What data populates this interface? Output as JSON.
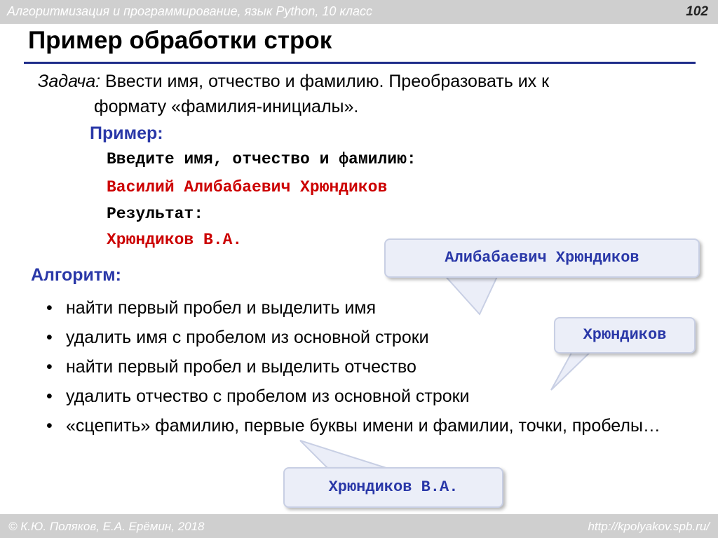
{
  "header": {
    "course": "Алгоритмизация и программирование, язык Python, 10 класс",
    "page_number": "102"
  },
  "title": "Пример обработки строк",
  "task": {
    "label": "Задача:",
    "text_line1": "Ввести имя, отчество и фамилию. Преобразовать их к",
    "text_line2": "формату «фамилия-инициалы»."
  },
  "example": {
    "heading": "Пример:",
    "prompt": "Введите имя, отчество и фамилию:",
    "input": "Василий Алибабаевич Хрюндиков",
    "result_label": "Результат:",
    "result": "Хрюндиков В.А."
  },
  "algorithm": {
    "heading": "Алгоритм:",
    "steps": [
      "найти первый пробел и выделить имя",
      "удалить имя с пробелом из основной строки",
      "найти первый пробел и выделить отчество",
      "удалить отчество с пробелом из основной строки",
      "«сцепить» фамилию, первые буквы имени и фамилии, точки, пробелы…"
    ]
  },
  "callouts": {
    "after_name": "Алибабаевич Хрюндиков",
    "after_patronymic": "Хрюндиков",
    "final": "Хрюндиков В.А."
  },
  "footer": {
    "copyright": "© К.Ю. Поляков, Е.А. Ерёмин, 2018",
    "url": "http://kpolyakov.spb.ru/"
  },
  "colors": {
    "accent_blue": "#2a38a8",
    "input_red": "#cc0000",
    "bar_gray": "#cfcfcf",
    "callout_fill": "#ebeef8"
  }
}
